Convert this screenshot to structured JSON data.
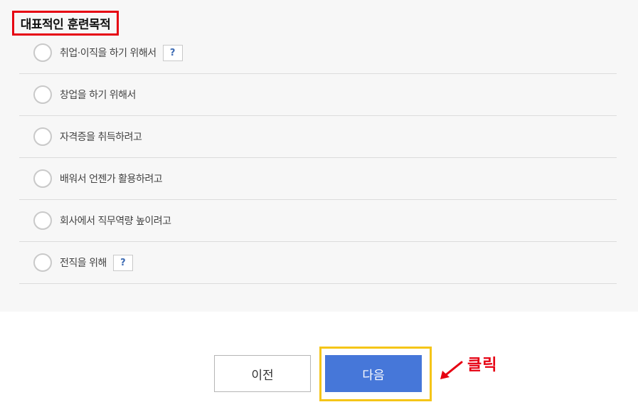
{
  "section": {
    "title": "대표적인 훈련목적"
  },
  "options": [
    {
      "label": "취업·이직을 하기 위해서",
      "help": "?"
    },
    {
      "label": "창업을 하기 위해서"
    },
    {
      "label": "자격증을 취득하려고"
    },
    {
      "label": "배워서 언젠가 활용하려고"
    },
    {
      "label": "회사에서 직무역량 높이려고"
    },
    {
      "label": "전직을 위해",
      "help": "?"
    }
  ],
  "buttons": {
    "prev_label": "이전",
    "next_label": "다음"
  },
  "annotation": {
    "click_label": "클릭"
  },
  "colors": {
    "accent": "#4677d9",
    "annotation": "#e60012",
    "highlight": "#f5c518"
  }
}
